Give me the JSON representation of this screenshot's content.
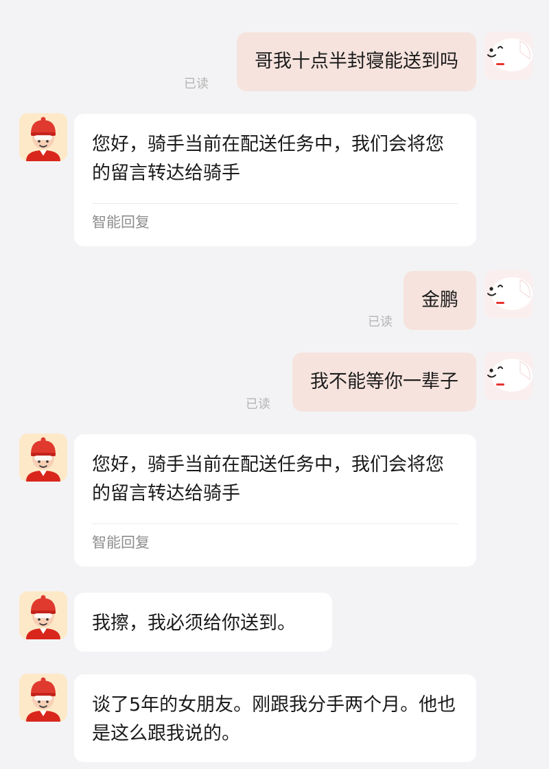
{
  "messages": [
    {
      "from": "user",
      "text": "哥我十点半封寝能送到吗",
      "status": "已读"
    },
    {
      "from": "rider",
      "text": "您好，骑手当前在配送任务中，我们会将您的留言转达给骑手",
      "footer": "智能回复"
    },
    {
      "from": "user",
      "text": "金鹏",
      "status": "已读"
    },
    {
      "from": "user",
      "text": "我不能等你一辈子",
      "status": "已读"
    },
    {
      "from": "rider",
      "text": "您好，骑手当前在配送任务中，我们会将您的留言转达给骑手",
      "footer": "智能回复"
    },
    {
      "from": "rider",
      "text": "我擦，我必须给你送到。"
    },
    {
      "from": "rider",
      "text": "谈了5年的女朋友。刚跟我分手两个月。他也是这么跟我说的。"
    }
  ],
  "avatars": {
    "user": "jd-dog-mascot-icon",
    "rider": "delivery-rider-avatar-icon"
  }
}
